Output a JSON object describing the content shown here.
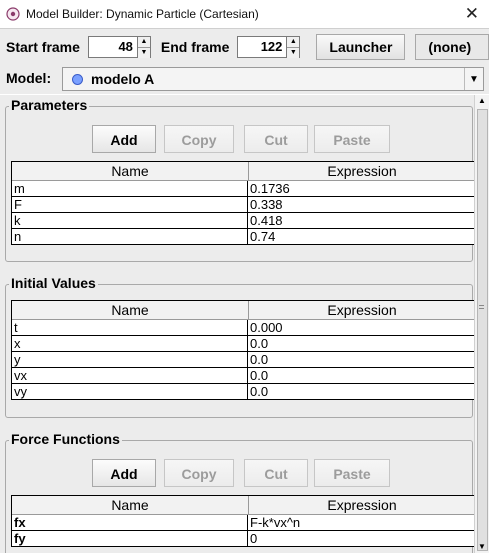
{
  "window": {
    "title": "Model Builder: Dynamic Particle (Cartesian)",
    "close": "✕"
  },
  "toolbar": {
    "start_label": "Start frame",
    "start_value": "48",
    "end_label": "End frame",
    "end_value": "122",
    "launcher_label": "Launcher",
    "launcher_value": "(none)"
  },
  "model": {
    "label": "Model:",
    "name": "modelo A",
    "dot_color": "#7aa0ff"
  },
  "buttons": {
    "add": "Add",
    "copy": "Copy",
    "cut": "Cut",
    "paste": "Paste"
  },
  "columns": {
    "name": "Name",
    "expression": "Expression"
  },
  "parameters": {
    "title": "Parameters",
    "rows": [
      {
        "name": "m",
        "expr": "0.1736"
      },
      {
        "name": "F",
        "expr": "0.338"
      },
      {
        "name": "k",
        "expr": "0.418"
      },
      {
        "name": "n",
        "expr": "0.74"
      }
    ]
  },
  "initial_values": {
    "title": "Initial Values",
    "rows": [
      {
        "name": "t",
        "expr": "0.000"
      },
      {
        "name": "x",
        "expr": "0.0"
      },
      {
        "name": "y",
        "expr": "0.0"
      },
      {
        "name": "vx",
        "expr": "0.0"
      },
      {
        "name": "vy",
        "expr": "0.0"
      }
    ]
  },
  "force_functions": {
    "title": "Force Functions",
    "rows": [
      {
        "name": "fx",
        "expr": "F-k*vx^n"
      },
      {
        "name": "fy",
        "expr": "0"
      }
    ]
  }
}
